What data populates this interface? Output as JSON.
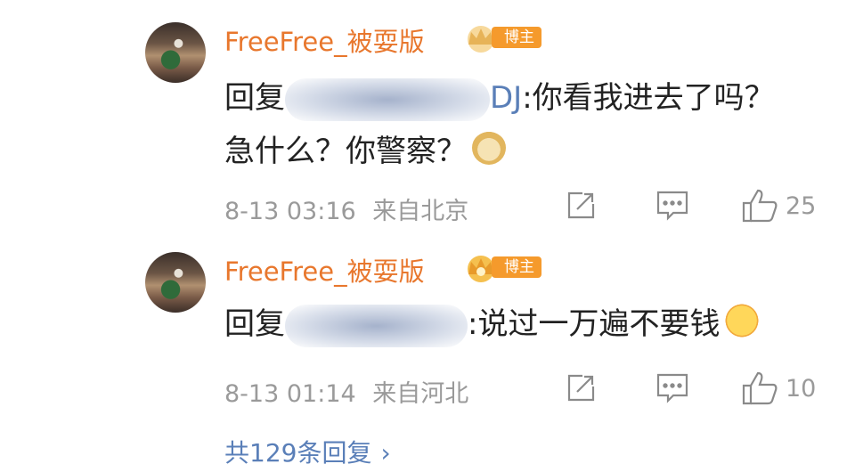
{
  "comments": [
    {
      "username": "FreeFree_被耍版",
      "badge_label": "博主",
      "reply_prefix": "回复",
      "mention_suffix": "DJ",
      "text": ":你看我进去了吗？急什么？你警察？",
      "emoji": "doge-emoji",
      "timestamp": "8-13 03:16",
      "location": "来自北京",
      "likes": "25"
    },
    {
      "username": "FreeFree_被耍版",
      "badge_label": "博主",
      "reply_prefix": "回复",
      "mention_suffix": "",
      "text": ":说过一万遍不要钱",
      "emoji": "smile-emoji",
      "timestamp": "8-13 01:14",
      "location": "来自河北",
      "likes": "10"
    }
  ],
  "footer": {
    "more_replies": "共129条回复"
  },
  "colors": {
    "username": "#e8772d",
    "badge_bg": "#f59a2c",
    "link": "#5a7fb8",
    "meta": "#9a9a9a"
  }
}
